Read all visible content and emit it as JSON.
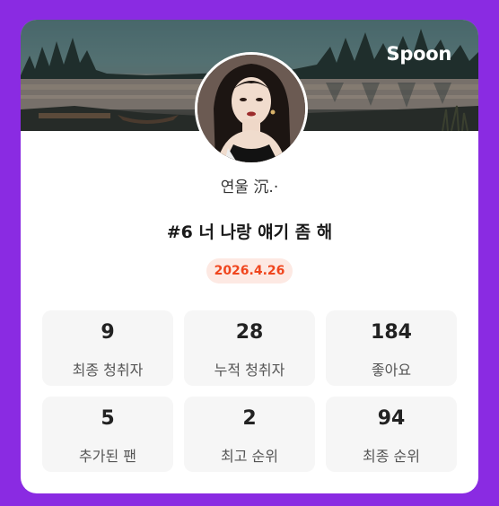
{
  "brand": "Spoon",
  "profile": {
    "name": "연울 沉.·"
  },
  "broadcast": {
    "title": "#6 너 나랑 얘기 좀 해",
    "date": "2026.4.26"
  },
  "stats": [
    {
      "value": "9",
      "label": "최종 청취자"
    },
    {
      "value": "28",
      "label": "누적 청취자"
    },
    {
      "value": "184",
      "label": "좋아요"
    },
    {
      "value": "5",
      "label": "추가된 팬"
    },
    {
      "value": "2",
      "label": "최고 순위"
    },
    {
      "value": "94",
      "label": "최종 순위"
    }
  ],
  "colors": {
    "background": "#8a2be2",
    "card": "#ffffff",
    "date_text": "#f0461e",
    "date_badge": "#fde9e3",
    "stat_tile": "#f6f6f6"
  }
}
